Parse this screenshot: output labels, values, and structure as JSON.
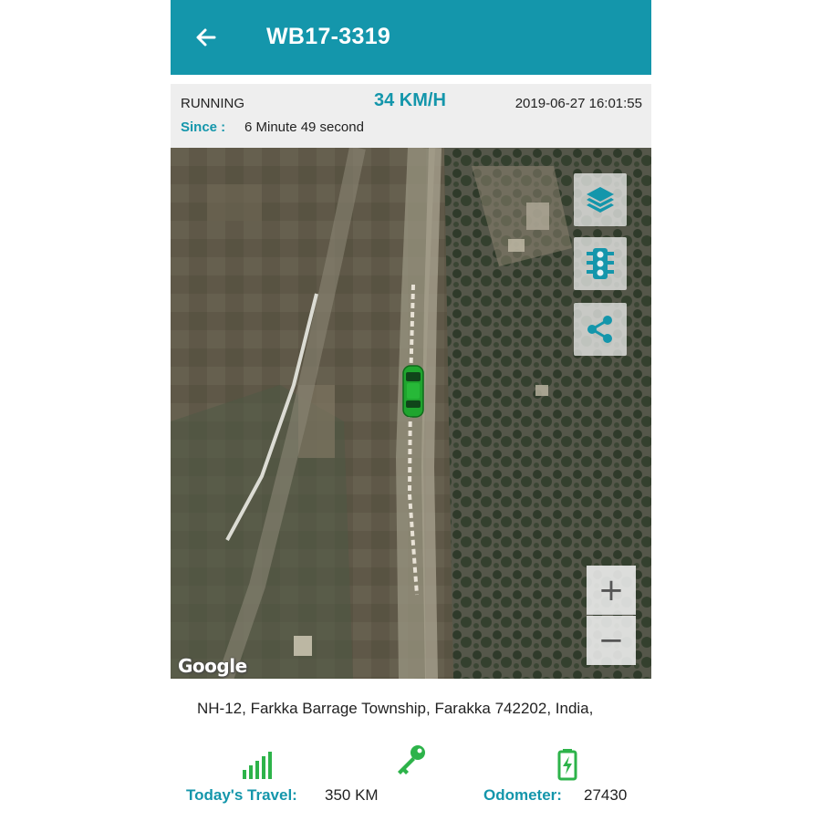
{
  "app_bar": {
    "title": "WB17-3319",
    "back_icon": "arrow-left-icon",
    "color": "#1496ab"
  },
  "status": {
    "state": "RUNNING",
    "speed": "34 KM/H",
    "datetime": "2019-06-27 16:01:55",
    "since_label": "Since :",
    "since_value": "6 Minute 49 second"
  },
  "map": {
    "provider": "Google",
    "controls": [
      {
        "name": "layers-button",
        "icon": "layers-icon"
      },
      {
        "name": "traffic-button",
        "icon": "traffic-light-icon"
      },
      {
        "name": "share-button",
        "icon": "share-icon"
      }
    ],
    "zoom_in_label": "+",
    "zoom_out_label": "−",
    "vehicle_marker": "car-icon",
    "vehicle_color": "#1fa52e"
  },
  "address": "NH-12, Farkka Barrage Township, Farakka 742202, India,",
  "stats": {
    "travel_label": "Today's Travel:",
    "travel_value": "350 KM",
    "ignition_icon": "key-icon",
    "signal_icon": "signal-bars-icon",
    "battery_icon": "battery-icon",
    "odometer_label": "Odometer:",
    "odometer_value": "27430"
  },
  "colors": {
    "accent": "#1496ab",
    "signal_green": "#2db34a"
  }
}
